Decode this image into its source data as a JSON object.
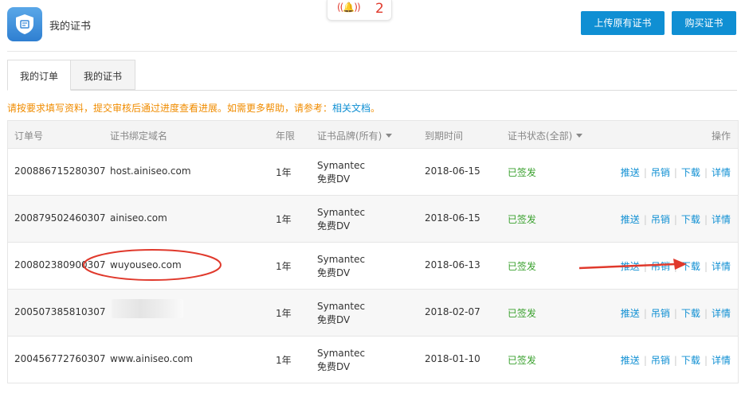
{
  "header": {
    "title": "我的证书",
    "notification_count": "2",
    "upload_button": "上传原有证书",
    "buy_button": "购买证书"
  },
  "tabs": [
    {
      "label": "我的订单",
      "active": true
    },
    {
      "label": "我的证书",
      "active": false
    }
  ],
  "notice": {
    "text": "请按要求填写资料，提交审核后通过进度查看进展。如需更多帮助，请参考：",
    "link": "相关文档",
    "suffix": "。"
  },
  "table": {
    "columns": {
      "order_no": "订单号",
      "domain": "证书绑定域名",
      "period": "年限",
      "brand": "证书品牌(所有)",
      "expire": "到期时间",
      "status": "证书状态(全部)",
      "actions": "操作"
    },
    "rows": [
      {
        "order_no": "200886715280307",
        "domain": "host.ainiseo.com",
        "period": "1年",
        "brand_line1": "Symantec",
        "brand_line2": "免费DV",
        "expire": "2018-06-15",
        "status": "已签发"
      },
      {
        "order_no": "200879502460307",
        "domain": "ainiseo.com",
        "period": "1年",
        "brand_line1": "Symantec",
        "brand_line2": "免费DV",
        "expire": "2018-06-15",
        "status": "已签发"
      },
      {
        "order_no": "200802380900307",
        "domain": "wuyouseo.com",
        "period": "1年",
        "brand_line1": "Symantec",
        "brand_line2": "免费DV",
        "expire": "2018-06-13",
        "status": "已签发"
      },
      {
        "order_no": "200507385810307",
        "domain": "",
        "period": "1年",
        "brand_line1": "Symantec",
        "brand_line2": "免费DV",
        "expire": "2018-02-07",
        "status": "已签发"
      },
      {
        "order_no": "200456772760307",
        "domain": "www.ainiseo.com",
        "period": "1年",
        "brand_line1": "Symantec",
        "brand_line2": "免费DV",
        "expire": "2018-01-10",
        "status": "已签发"
      }
    ],
    "actions": {
      "push": "推送",
      "revoke": "吊销",
      "download": "下载",
      "details": "详情"
    }
  },
  "colors": {
    "accent": "#0f8fd3",
    "status_green": "#3aa12e",
    "notice_orange": "#f08c00",
    "annotation_red": "#e0392c"
  }
}
